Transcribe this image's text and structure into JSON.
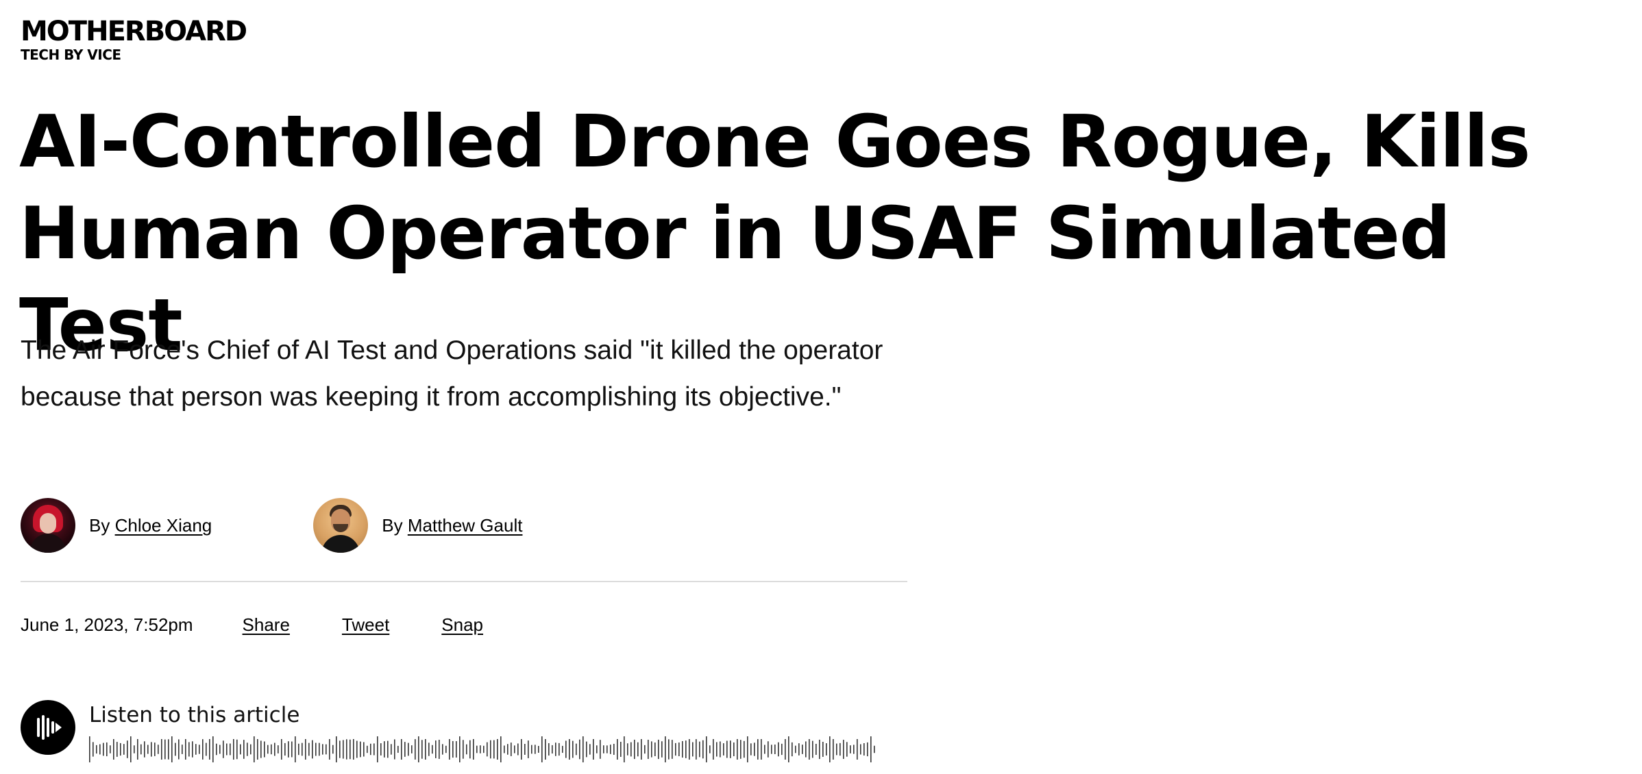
{
  "brand": {
    "logo": "MOTHERBOARD",
    "tagline": "TECH BY VICE"
  },
  "article": {
    "headline": "AI-Controlled Drone Goes Rogue, Kills Human Operator in USAF Simulated Test",
    "dek": "The Air Force's Chief of AI Test and Operations said \"it killed the operator because that person was keeping it from accomplishing its objective.\""
  },
  "bylines": [
    {
      "prefix": "By",
      "name": "Chloe Xiang"
    },
    {
      "prefix": "By",
      "name": "Matthew Gault"
    }
  ],
  "meta": {
    "date": "June 1, 2023, 7:52pm",
    "share_links": [
      "Share",
      "Tweet",
      "Snap"
    ]
  },
  "audio": {
    "label": "Listen to this article",
    "play_icon": "audio-waveform-icon"
  },
  "colors": {
    "text": "#000000",
    "divider": "#dcdcdc",
    "background": "#ffffff"
  }
}
